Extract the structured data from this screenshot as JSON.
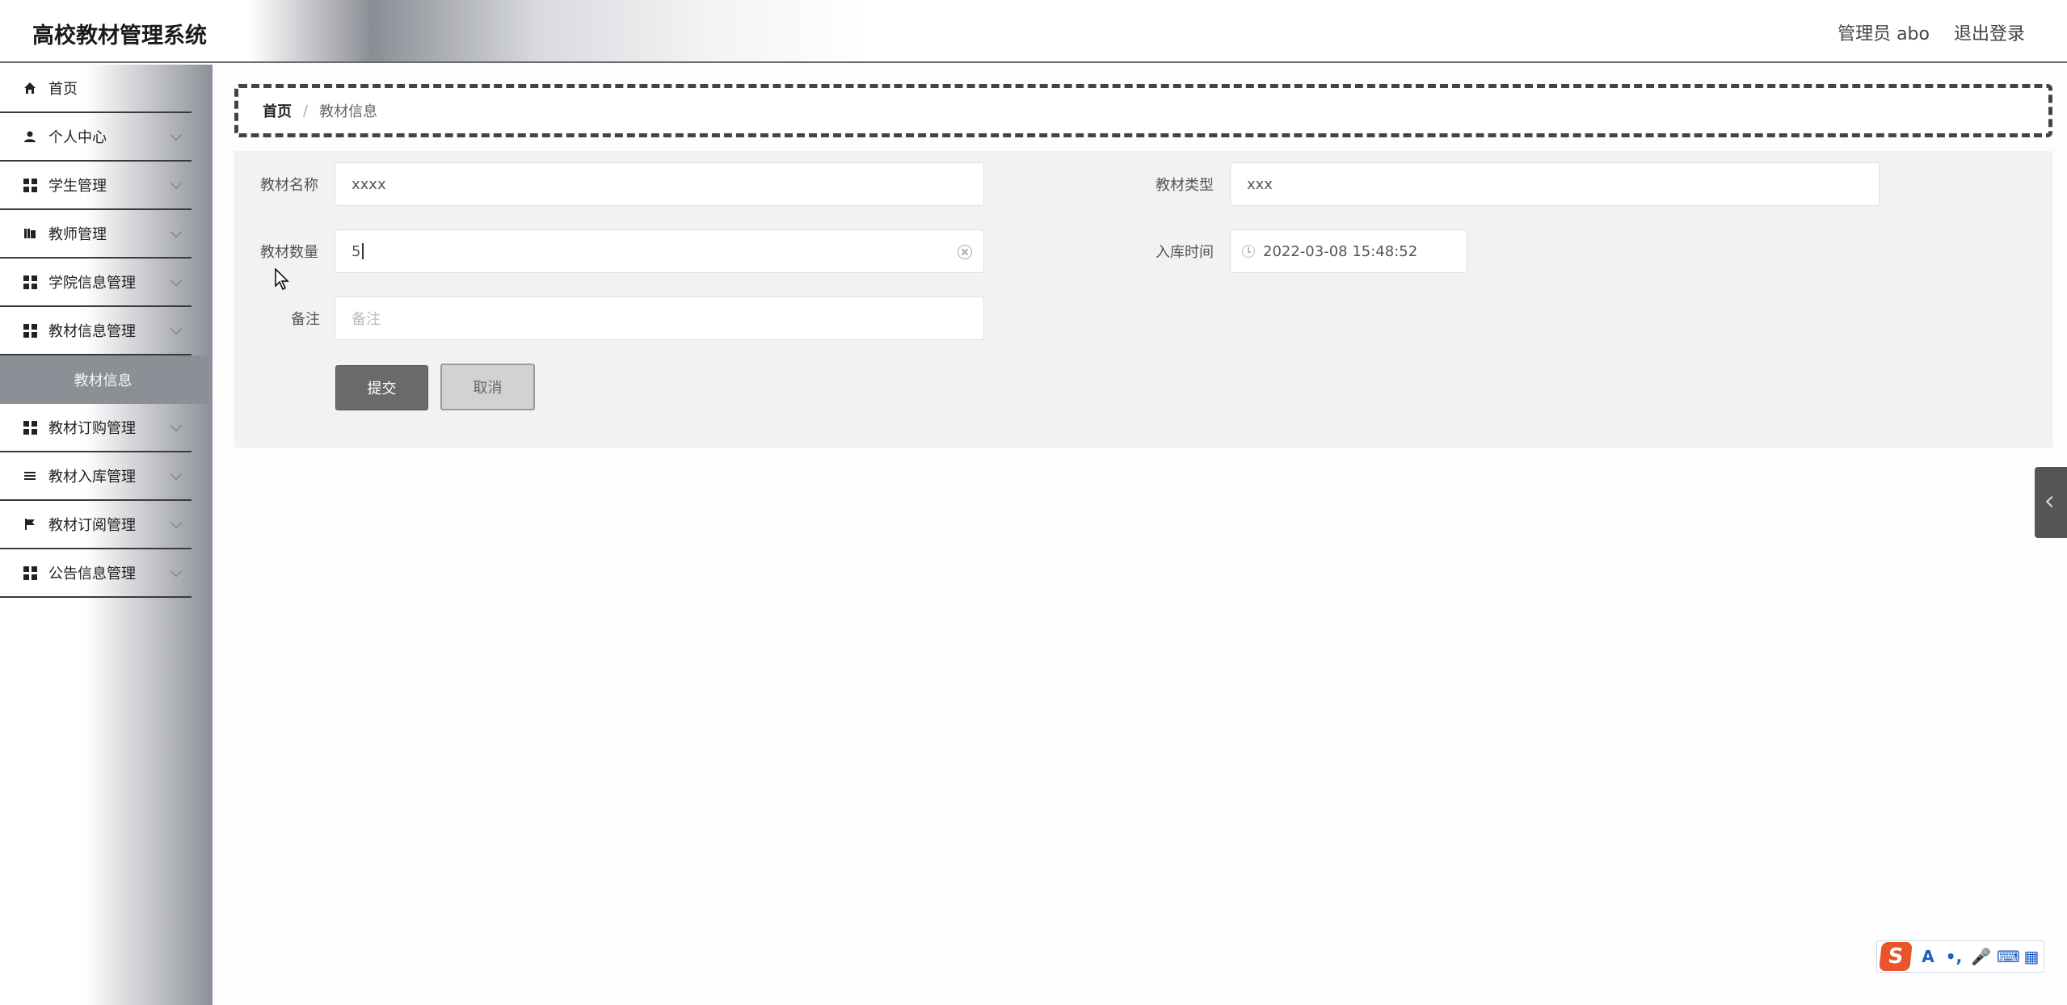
{
  "app": {
    "title": "高校教材管理系统"
  },
  "header": {
    "user_label": "管理员 abo",
    "logout_label": "退出登录"
  },
  "sidebar": {
    "items": [
      {
        "label": "首页",
        "icon": "home-icon",
        "has_chevron": false
      },
      {
        "label": "个人中心",
        "icon": "user-icon",
        "has_chevron": true
      },
      {
        "label": "学生管理",
        "icon": "grid-icon",
        "has_chevron": true
      },
      {
        "label": "教师管理",
        "icon": "book-icon",
        "has_chevron": true
      },
      {
        "label": "学院信息管理",
        "icon": "grid-icon",
        "has_chevron": true
      },
      {
        "label": "教材信息管理",
        "icon": "grid-icon",
        "has_chevron": true
      },
      {
        "label": "教材订购管理",
        "icon": "grid-icon",
        "has_chevron": true
      },
      {
        "label": "教材入库管理",
        "icon": "list-icon",
        "has_chevron": true
      },
      {
        "label": "教材订阅管理",
        "icon": "flag-icon",
        "has_chevron": true
      },
      {
        "label": "公告信息管理",
        "icon": "grid-icon",
        "has_chevron": true
      }
    ],
    "active_sub": "教材信息"
  },
  "breadcrumb": {
    "home": "首页",
    "separator": "/",
    "current": "教材信息"
  },
  "form": {
    "name_label": "教材名称",
    "name_value": "xxxx",
    "type_label": "教材类型",
    "type_value": "xxx",
    "qty_label": "教材数量",
    "qty_value": "5",
    "time_label": "入库时间",
    "time_value": "2022-03-08 15:48:52",
    "note_label": "备注",
    "note_placeholder": "备注",
    "submit_label": "提交",
    "cancel_label": "取消"
  },
  "ime": {
    "logo": "S",
    "buttons": [
      "A",
      "•,",
      "🎤",
      "⌨",
      "▦"
    ]
  },
  "colors": {
    "header_title": "#1a1a1a",
    "submit_bg": "#6a6a6a",
    "active_sub_bg": "#8c8f96"
  }
}
